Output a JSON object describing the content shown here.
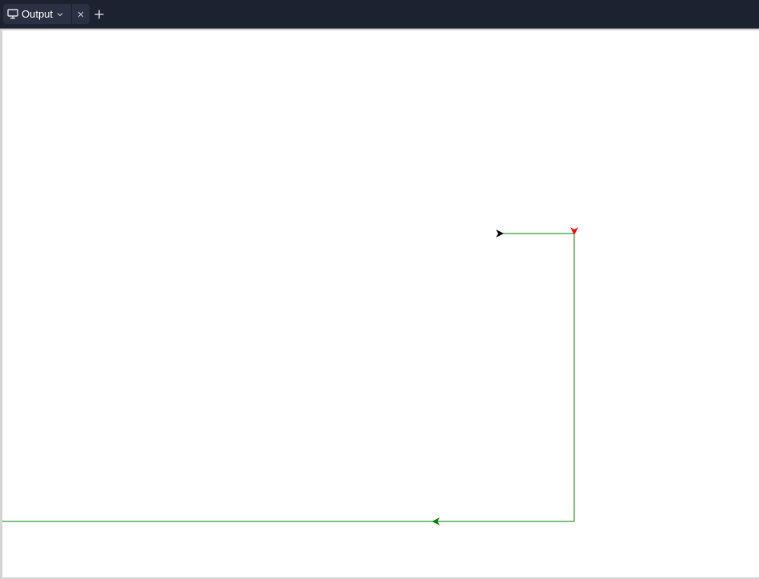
{
  "tab": {
    "icon": "monitor-icon",
    "label": "Output"
  },
  "colors": {
    "titlebar": "#1d2231",
    "tab_bg": "#2b3042",
    "path_line": "#008000",
    "start_marker": "#000000",
    "end_marker": "#ff0000",
    "direction_marker": "#008000",
    "canvas_bg": "#ffffff"
  },
  "canvas": {
    "content": "turtle-path",
    "start_marker_color": "black",
    "end_marker_color": "red",
    "direction_marker_color": "green"
  }
}
